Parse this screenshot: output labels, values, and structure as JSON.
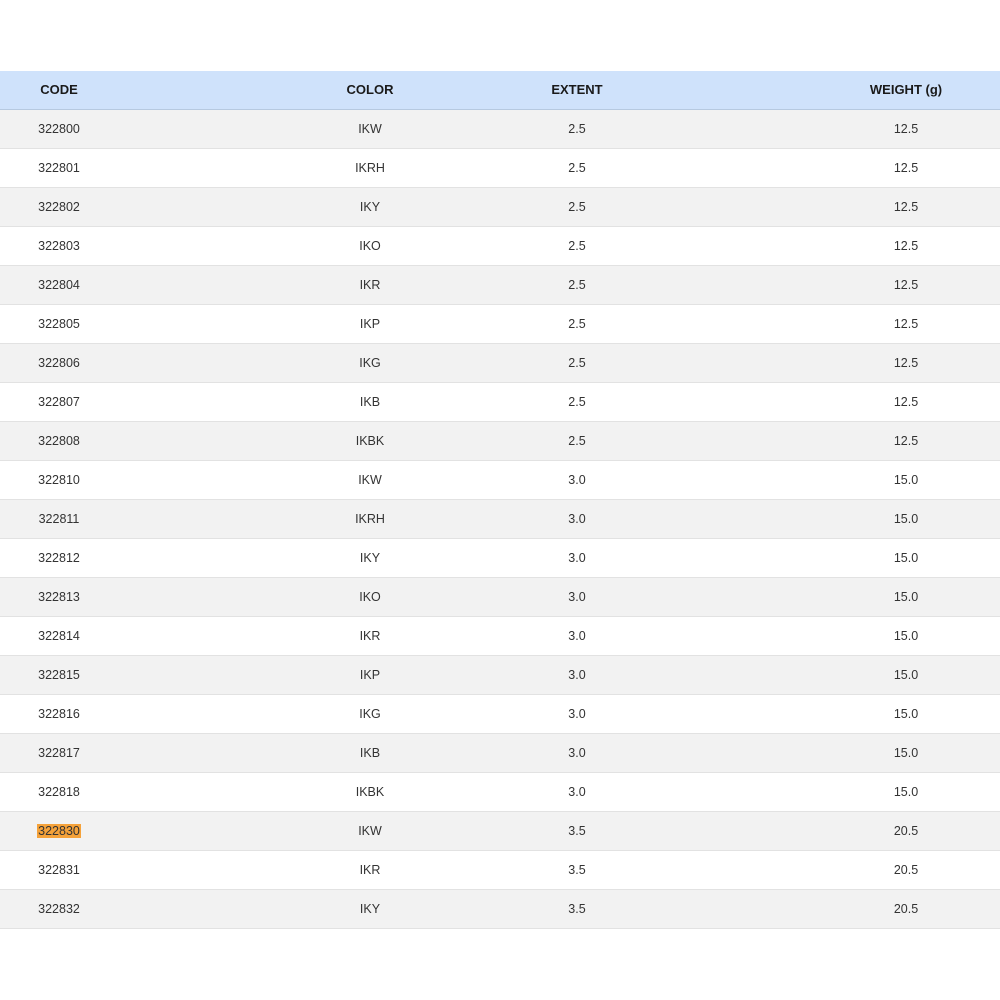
{
  "table": {
    "headers": {
      "code": "CODE",
      "color": "COLOR",
      "extent": "EXTENT",
      "weight": "WEIGHT (g)"
    },
    "highlight_color": "#f5a23a",
    "header_background": "#cfe2fb",
    "rows": [
      {
        "code": "322800",
        "color": "IKW",
        "extent": "2.5",
        "weight": "12.5",
        "highlighted": false
      },
      {
        "code": "322801",
        "color": "IKRH",
        "extent": "2.5",
        "weight": "12.5",
        "highlighted": false
      },
      {
        "code": "322802",
        "color": "IKY",
        "extent": "2.5",
        "weight": "12.5",
        "highlighted": false
      },
      {
        "code": "322803",
        "color": "IKO",
        "extent": "2.5",
        "weight": "12.5",
        "highlighted": false
      },
      {
        "code": "322804",
        "color": "IKR",
        "extent": "2.5",
        "weight": "12.5",
        "highlighted": false
      },
      {
        "code": "322805",
        "color": "IKP",
        "extent": "2.5",
        "weight": "12.5",
        "highlighted": false
      },
      {
        "code": "322806",
        "color": "IKG",
        "extent": "2.5",
        "weight": "12.5",
        "highlighted": false
      },
      {
        "code": "322807",
        "color": "IKB",
        "extent": "2.5",
        "weight": "12.5",
        "highlighted": false
      },
      {
        "code": "322808",
        "color": "IKBK",
        "extent": "2.5",
        "weight": "12.5",
        "highlighted": false
      },
      {
        "code": "322810",
        "color": "IKW",
        "extent": "3.0",
        "weight": "15.0",
        "highlighted": false
      },
      {
        "code": "322811",
        "color": "IKRH",
        "extent": "3.0",
        "weight": "15.0",
        "highlighted": false
      },
      {
        "code": "322812",
        "color": "IKY",
        "extent": "3.0",
        "weight": "15.0",
        "highlighted": false
      },
      {
        "code": "322813",
        "color": "IKO",
        "extent": "3.0",
        "weight": "15.0",
        "highlighted": false
      },
      {
        "code": "322814",
        "color": "IKR",
        "extent": "3.0",
        "weight": "15.0",
        "highlighted": false
      },
      {
        "code": "322815",
        "color": "IKP",
        "extent": "3.0",
        "weight": "15.0",
        "highlighted": false
      },
      {
        "code": "322816",
        "color": "IKG",
        "extent": "3.0",
        "weight": "15.0",
        "highlighted": false
      },
      {
        "code": "322817",
        "color": "IKB",
        "extent": "3.0",
        "weight": "15.0",
        "highlighted": false
      },
      {
        "code": "322818",
        "color": "IKBK",
        "extent": "3.0",
        "weight": "15.0",
        "highlighted": false
      },
      {
        "code": "322830",
        "color": "IKW",
        "extent": "3.5",
        "weight": "20.5",
        "highlighted": true
      },
      {
        "code": "322831",
        "color": "IKR",
        "extent": "3.5",
        "weight": "20.5",
        "highlighted": false
      },
      {
        "code": "322832",
        "color": "IKY",
        "extent": "3.5",
        "weight": "20.5",
        "highlighted": false
      }
    ]
  }
}
